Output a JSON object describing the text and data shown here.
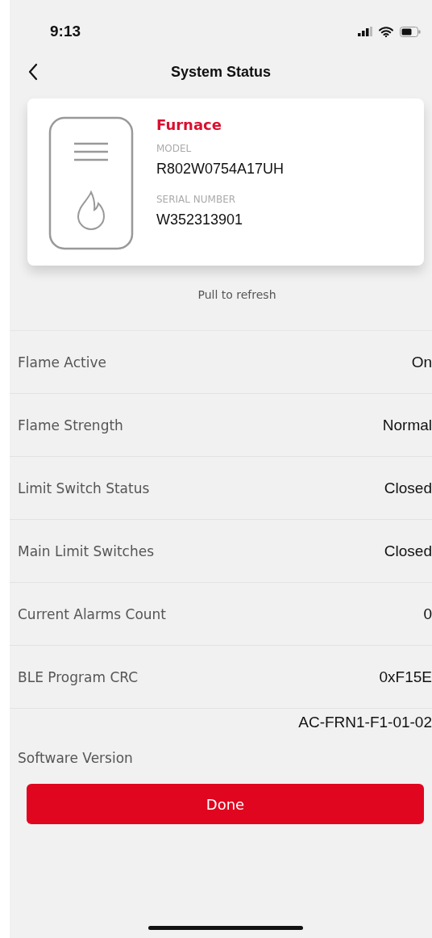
{
  "status_bar": {
    "time": "9:13"
  },
  "header": {
    "title": "System Status"
  },
  "device": {
    "name": "Furnace",
    "model_label": "MODEL",
    "model": "R802W0754A17UH",
    "serial_label": "SERIAL NUMBER",
    "serial": "W352313901"
  },
  "pull_hint": "Pull to refresh",
  "rows": [
    {
      "label": "Flame Active",
      "value": "On"
    },
    {
      "label": "Flame Strength",
      "value": "Normal"
    },
    {
      "label": "Limit Switch Status",
      "value": "Closed"
    },
    {
      "label": "Main Limit Switches",
      "value": "Closed"
    },
    {
      "label": "Current Alarms Count",
      "value": "0"
    },
    {
      "label": "BLE Program CRC",
      "value": "0xF15E"
    },
    {
      "label": "Software Version",
      "value": "AC-FRN1-F1-01-02"
    }
  ],
  "done_button": "Done"
}
